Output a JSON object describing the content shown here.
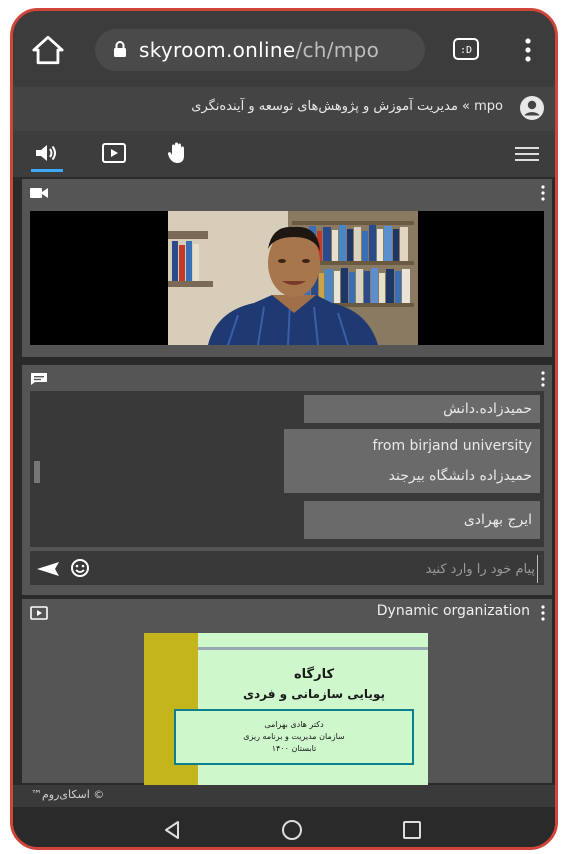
{
  "browser": {
    "url_host": "skyroom.online",
    "url_path": "/ch/mpo",
    "tabs_badge": ":D",
    "home_icon": "home-icon",
    "lock_icon": "lock-icon",
    "menu_icon": "more-vert-icon"
  },
  "breadcrumb": {
    "text": "mpo » مدیریت آموزش و پژوهش‌های توسعه و آینده‌نگری",
    "user_icon": "account-circle-icon"
  },
  "toolbar": {
    "items": [
      "audio-icon",
      "presentation-icon",
      "raise-hand-icon"
    ],
    "menu_icon": "hamburger-menu-icon",
    "accent": "#3fa9f5"
  },
  "video_panel": {
    "icon": "video-camera-icon"
  },
  "chat_panel": {
    "icon": "chat-icon",
    "messages": [
      {
        "lines": [
          "حمیدزاده.دانش"
        ]
      },
      {
        "lines": [
          "from birjand university",
          "حمیدزاده دانشگاه بیرجند"
        ]
      },
      {
        "lines": [
          "ایرج بهرادی"
        ]
      }
    ],
    "input_placeholder": "پیام خود را وارد کنید",
    "send_icon": "send-icon",
    "emoji_icon": "emoji-icon"
  },
  "presentation_panel": {
    "icon": "presentation-icon",
    "title": "Dynamic organization",
    "slide": {
      "title": "کارگاه",
      "subtitle": "پویایی سازمانی و فردی",
      "box_lines": [
        "دکتر هادی بهرامی",
        "سازمان مدیریت و برنامه ریزی",
        "تابستان ۱۴۰۰"
      ]
    }
  },
  "footer": {
    "text": "© اسکای‌روم™"
  },
  "android_nav": [
    "back-icon",
    "home-circle-icon",
    "recents-icon"
  ],
  "colors": {
    "frame_border": "#d0453a",
    "slide_bg": "#cff7cc",
    "slide_accent": "#c3b51b",
    "slide_box_border": "#0e7f8f"
  }
}
